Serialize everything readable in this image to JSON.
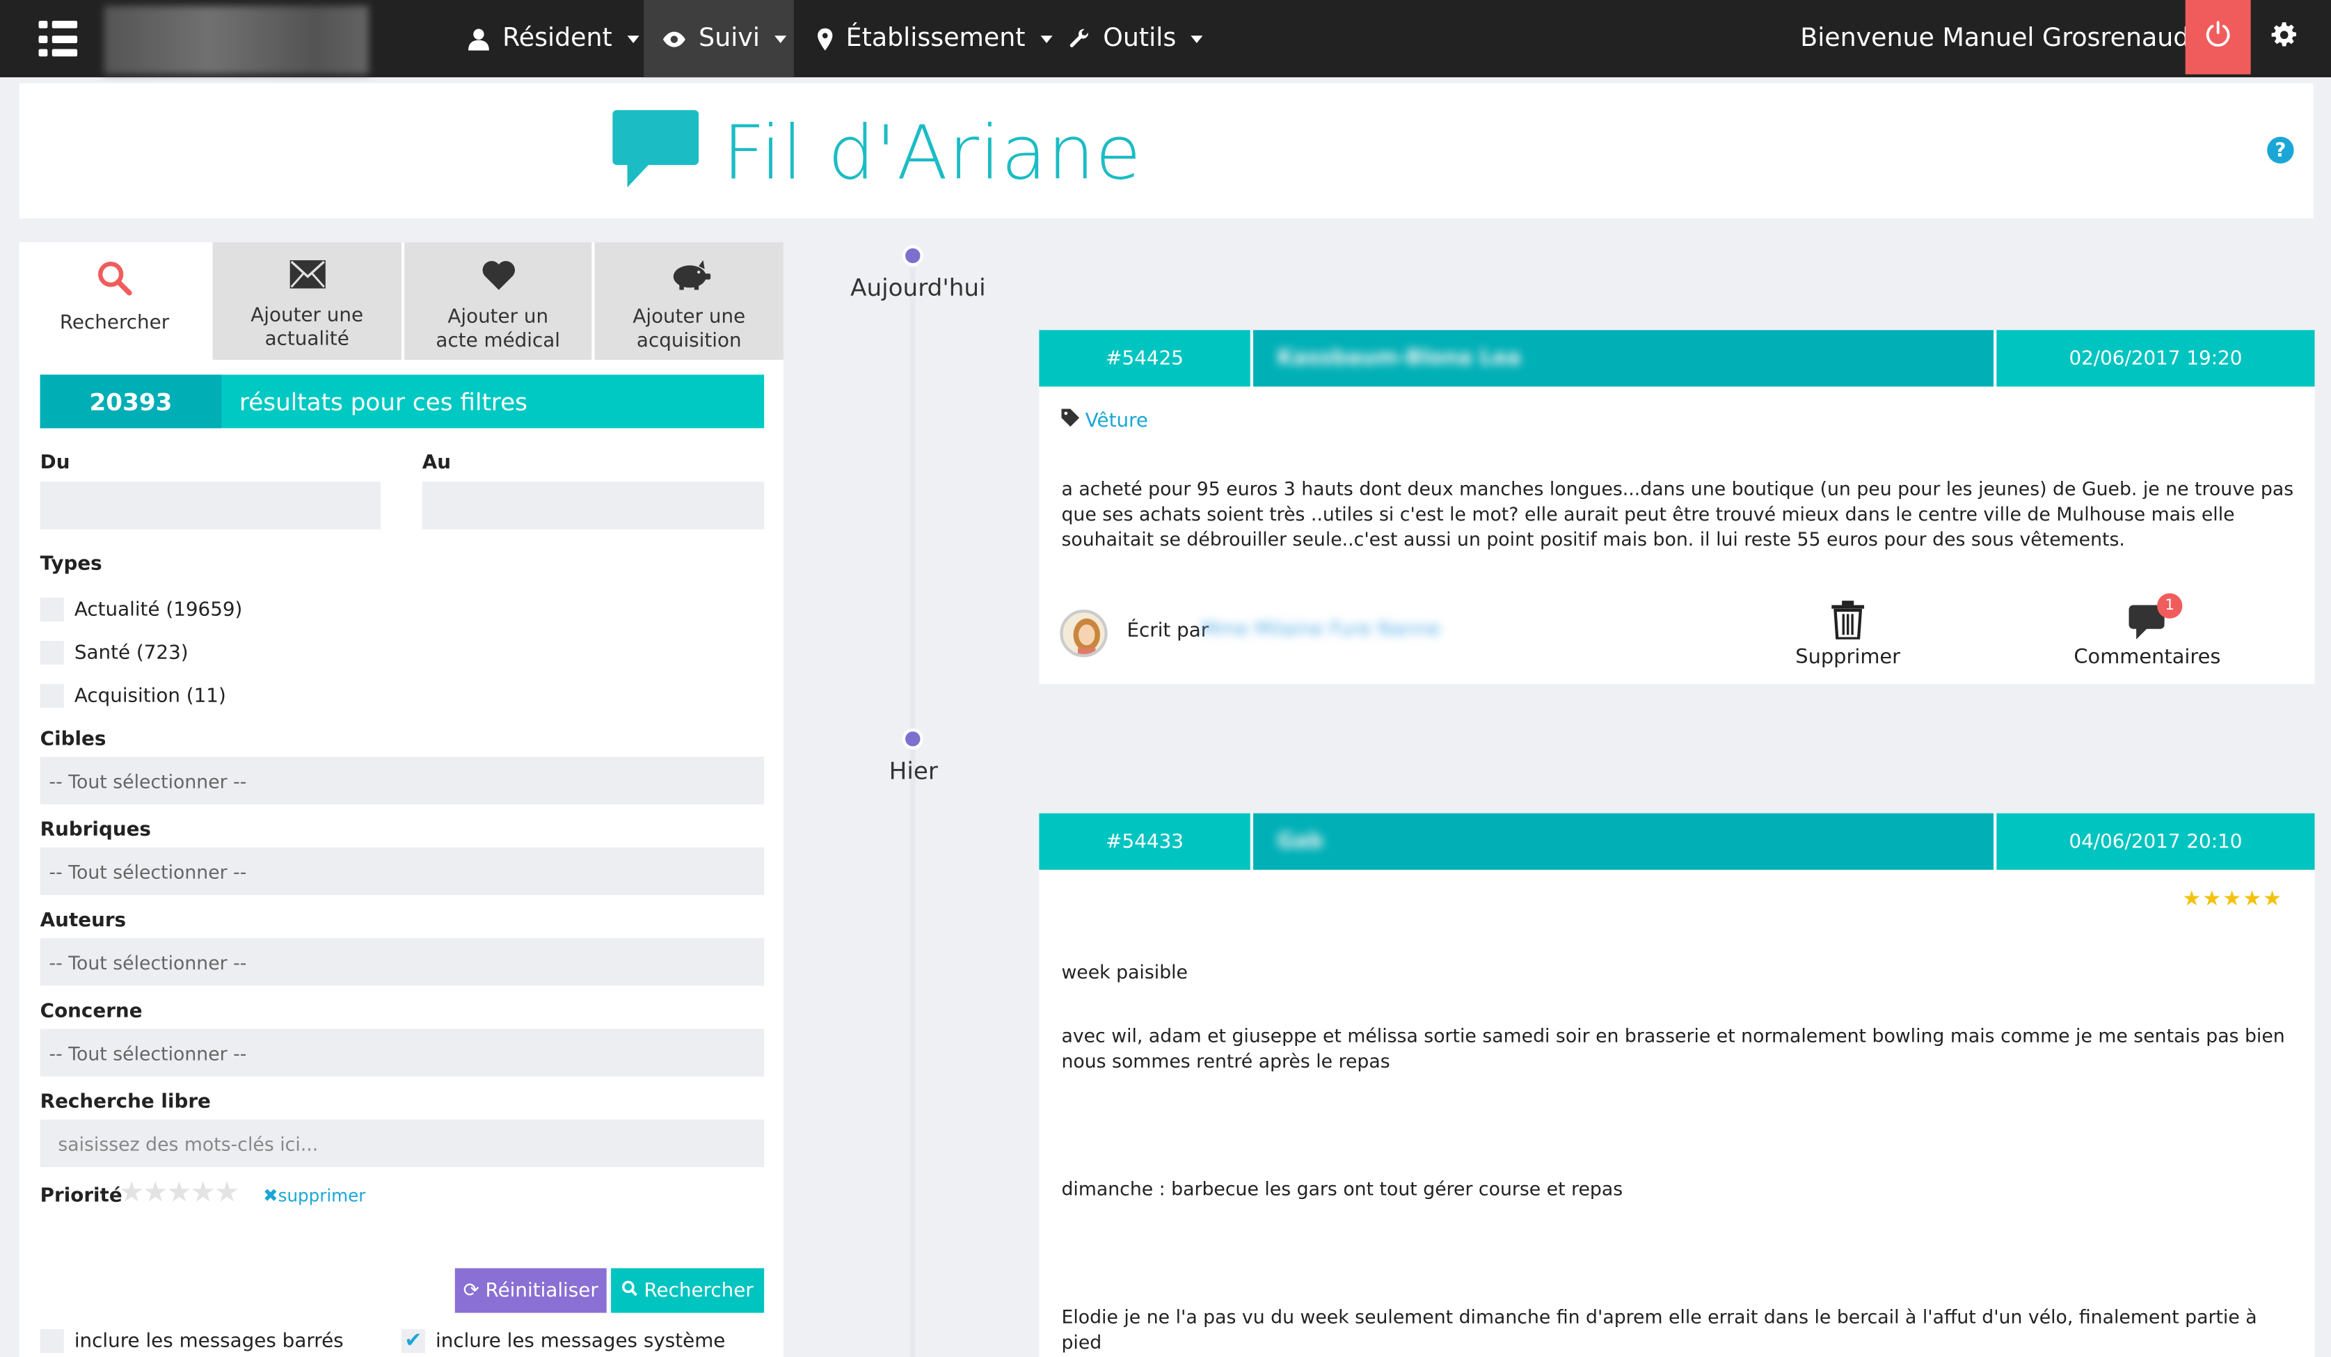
{
  "nav": {
    "logo_text": "MECSOFT",
    "items": [
      {
        "label": "Résident",
        "icon": "user-icon"
      },
      {
        "label": "Suivi",
        "icon": "eye-icon"
      },
      {
        "label": "Établissement",
        "icon": "map-marker-icon"
      },
      {
        "label": "Outils",
        "icon": "wrench-icon"
      }
    ],
    "welcome": "Bienvenue Manuel Grosrenaud",
    "accent_power": "#f05c5c"
  },
  "header": {
    "title": "Fil d'Ariane",
    "title_color": "#1bbcc4"
  },
  "tabs": [
    {
      "label": "Rechercher",
      "icon": "search-icon"
    },
    {
      "label": "Ajouter une actualité",
      "icon": "envelope-icon"
    },
    {
      "label": "Ajouter un acte médical",
      "icon": "heart-icon"
    },
    {
      "label": "Ajouter une acquisition",
      "icon": "piggy-bank-icon"
    }
  ],
  "results": {
    "count": "20393",
    "label": "résultats pour ces filtres"
  },
  "filters": {
    "du": "Du",
    "au": "Au",
    "types_label": "Types",
    "types": [
      "Actualité (19659)",
      "Santé (723)",
      "Acquisition (11)"
    ],
    "cibles_label": "Cibles",
    "rubriques_label": "Rubriques",
    "auteurs_label": "Auteurs",
    "concerne_label": "Concerne",
    "select_all": "-- Tout sélectionner --",
    "libre_label": "Recherche libre",
    "libre_placeholder": "saisissez des mots-clés ici...",
    "priorite_label": "Priorité",
    "priorite_value": 0,
    "supprimer": "supprimer",
    "reset_label": "Réinitialiser",
    "search_label": "Rechercher",
    "opt_barres": "inclure les messages barrés",
    "opt_systeme": "inclure les messages système",
    "opt_barres_checked": false,
    "opt_systeme_checked": true
  },
  "timeline": {
    "today": "Aujourd'hui",
    "yesterday": "Hier"
  },
  "posts": [
    {
      "id": "#54425",
      "name": "Kassbaum-Blona Lea",
      "date": "02/06/2017 19:20",
      "tag": "Vêture",
      "text": "a acheté pour 95 euros 3 hauts dont deux manches longues...dans une boutique (un peu pour les jeunes) de Gueb. je ne trouve pas que ses achats soient très ..utiles si c'est le mot? elle aurait peut être trouvé mieux dans le centre ville de Mulhouse mais elle souhaitait se débrouiller seule..c'est aussi un point positif mais bon. il lui reste 55 euros pour des sous vêtements.",
      "written_by": "Écrit par",
      "author": "Mme Milaine Fure Nanne",
      "delete_label": "Supprimer",
      "comments_label": "Commentaires",
      "comments_count": "1"
    },
    {
      "id": "#54433",
      "name": "Gab",
      "date": "04/06/2017 20:10",
      "rating": 5,
      "p1": "week paisible",
      "p2": "avec wil, adam et giuseppe et mélissa sortie samedi soir en brasserie et normalement bowling mais comme je me sentais pas bien nous sommes rentré après le repas",
      "p3": "dimanche : barbecue les gars ont tout gérer course et repas",
      "p4": "Elodie je ne l'a pas vu du week seulement dimanche fin d'aprem elle errait dans le bercail à l'affut d'un vélo, finalement partie à pied"
    }
  ]
}
